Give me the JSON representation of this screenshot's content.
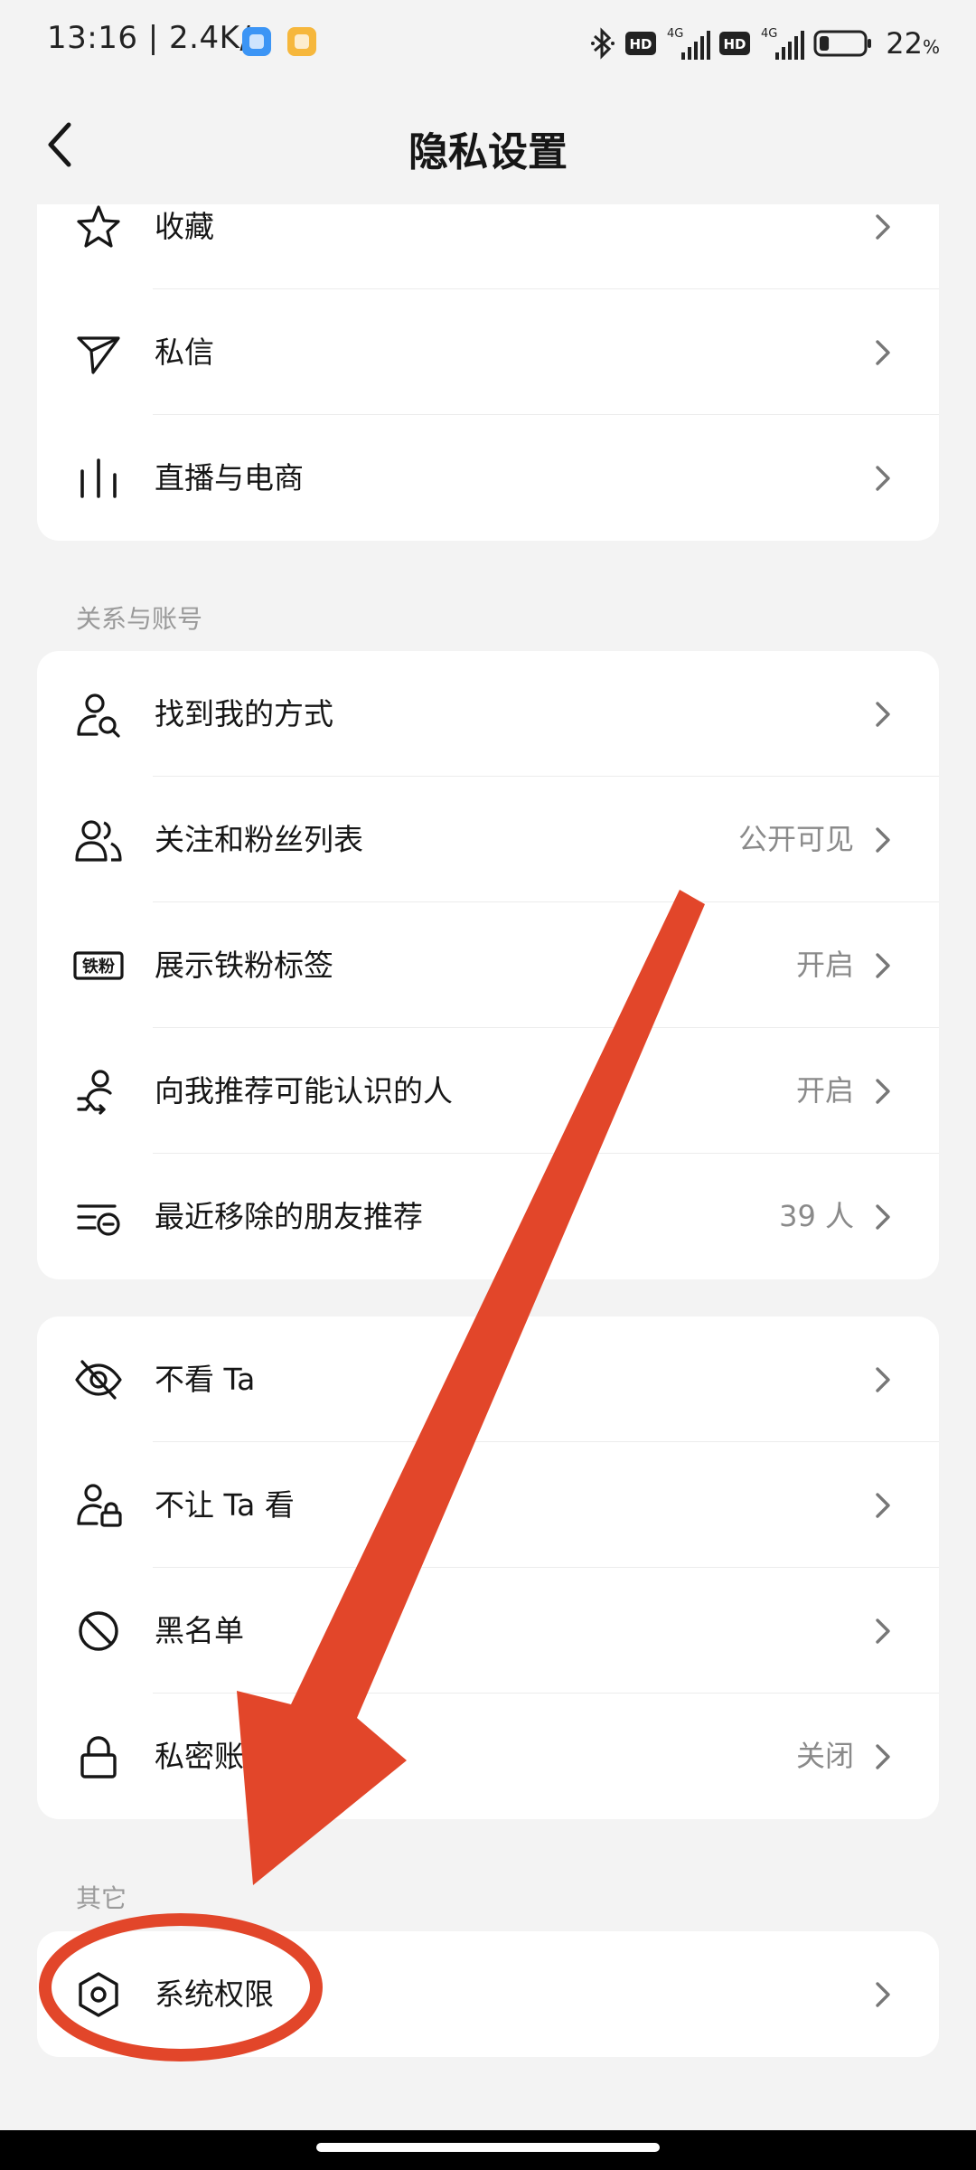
{
  "status_bar": {
    "time_speed": "13:16 | 2.4K/s",
    "network_1": "4G",
    "network_2": "4G",
    "hd_1": "HD",
    "hd_2": "HD",
    "battery": "22",
    "battery_unit": "%",
    "battery_level": 0.22
  },
  "header": {
    "title": "隐私设置"
  },
  "card_top": {
    "items": [
      {
        "label": "收藏",
        "icon": "star-icon"
      },
      {
        "label": "私信",
        "icon": "send-icon"
      },
      {
        "label": "直播与电商",
        "icon": "live-bars-icon"
      }
    ]
  },
  "section_relations": {
    "title": "关系与账号",
    "items": [
      {
        "label": "找到我的方式",
        "value": "",
        "icon": "person-search-icon"
      },
      {
        "label": "关注和粉丝列表",
        "value": "公开可见",
        "icon": "people-icon"
      },
      {
        "label": "展示铁粉标签",
        "value": "开启",
        "icon": "iron-fan-badge-icon",
        "badge_text": "铁粉"
      },
      {
        "label": "向我推荐可能认识的人",
        "value": "开启",
        "icon": "person-recommend-icon"
      },
      {
        "label": "最近移除的朋友推荐",
        "value": "39 人",
        "icon": "list-remove-icon"
      }
    ]
  },
  "card_block": {
    "items": [
      {
        "label": "不看 Ta",
        "value": "",
        "icon": "eye-off-icon"
      },
      {
        "label": "不让 Ta 看",
        "value": "",
        "icon": "person-lock-icon"
      },
      {
        "label": "黑名单",
        "value": "",
        "icon": "block-icon"
      },
      {
        "label": "私密账",
        "value": "关闭",
        "icon": "lock-icon"
      }
    ]
  },
  "section_other": {
    "title": "其它",
    "items": [
      {
        "label": "系统权限",
        "icon": "hex-settings-icon"
      }
    ]
  },
  "annotation": {
    "arrow_color": "#e2462a",
    "circle_color": "#e2462a"
  }
}
